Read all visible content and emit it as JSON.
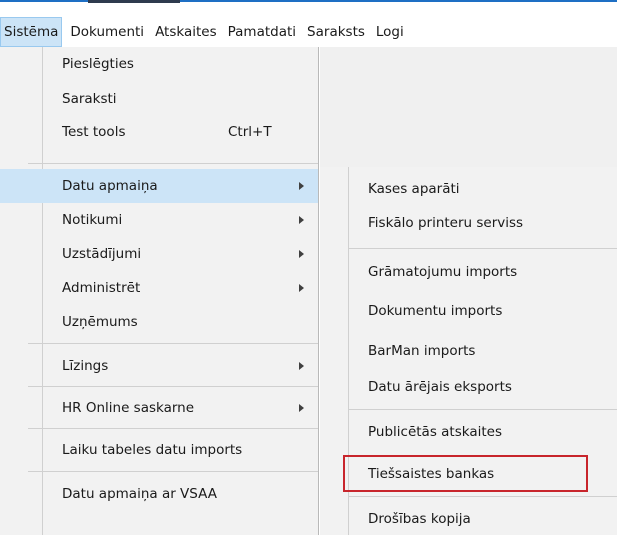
{
  "menubar": {
    "items": [
      {
        "label": "Sistēma",
        "active": true
      },
      {
        "label": "Dokumenti"
      },
      {
        "label": "Atskaites"
      },
      {
        "label": "Pamatdati"
      },
      {
        "label": "Saraksts"
      },
      {
        "label": "Logi"
      }
    ]
  },
  "system_menu": {
    "items": [
      {
        "label": "Pieslēgties"
      },
      {
        "label": "Saraksti"
      },
      {
        "label": "Test tools",
        "shortcut": "Ctrl+T"
      },
      {
        "label": "Datu apmaiņa",
        "submenu": true,
        "highlighted": true
      },
      {
        "label": "Notikumi",
        "submenu": true
      },
      {
        "label": "Uzstādījumi",
        "submenu": true
      },
      {
        "label": "Administrēt",
        "submenu": true
      },
      {
        "label": "Uzņēmums"
      },
      {
        "label": "Līzings",
        "submenu": true
      },
      {
        "label": "HR Online saskarne",
        "submenu": true
      },
      {
        "label": "Laiku tabeles datu imports"
      },
      {
        "label": "Datu apmaiņa ar VSAA"
      }
    ]
  },
  "datu_apmaina_submenu": {
    "items": [
      {
        "label": "Kases aparāti"
      },
      {
        "label": "Fiskālo printeru serviss"
      },
      {
        "label": "Grāmatojumu imports"
      },
      {
        "label": "Dokumentu imports"
      },
      {
        "label": "BarMan imports"
      },
      {
        "label": "Datu ārējais eksports"
      },
      {
        "label": "Publicētās atskaites"
      },
      {
        "label": "Tiešsaistes bankas",
        "outlined": true
      },
      {
        "label": "Drošības kopija"
      }
    ]
  },
  "colors": {
    "menu_bg": "#f2f2f2",
    "highlight": "#cce4f7",
    "outline_red": "#c8252c"
  }
}
